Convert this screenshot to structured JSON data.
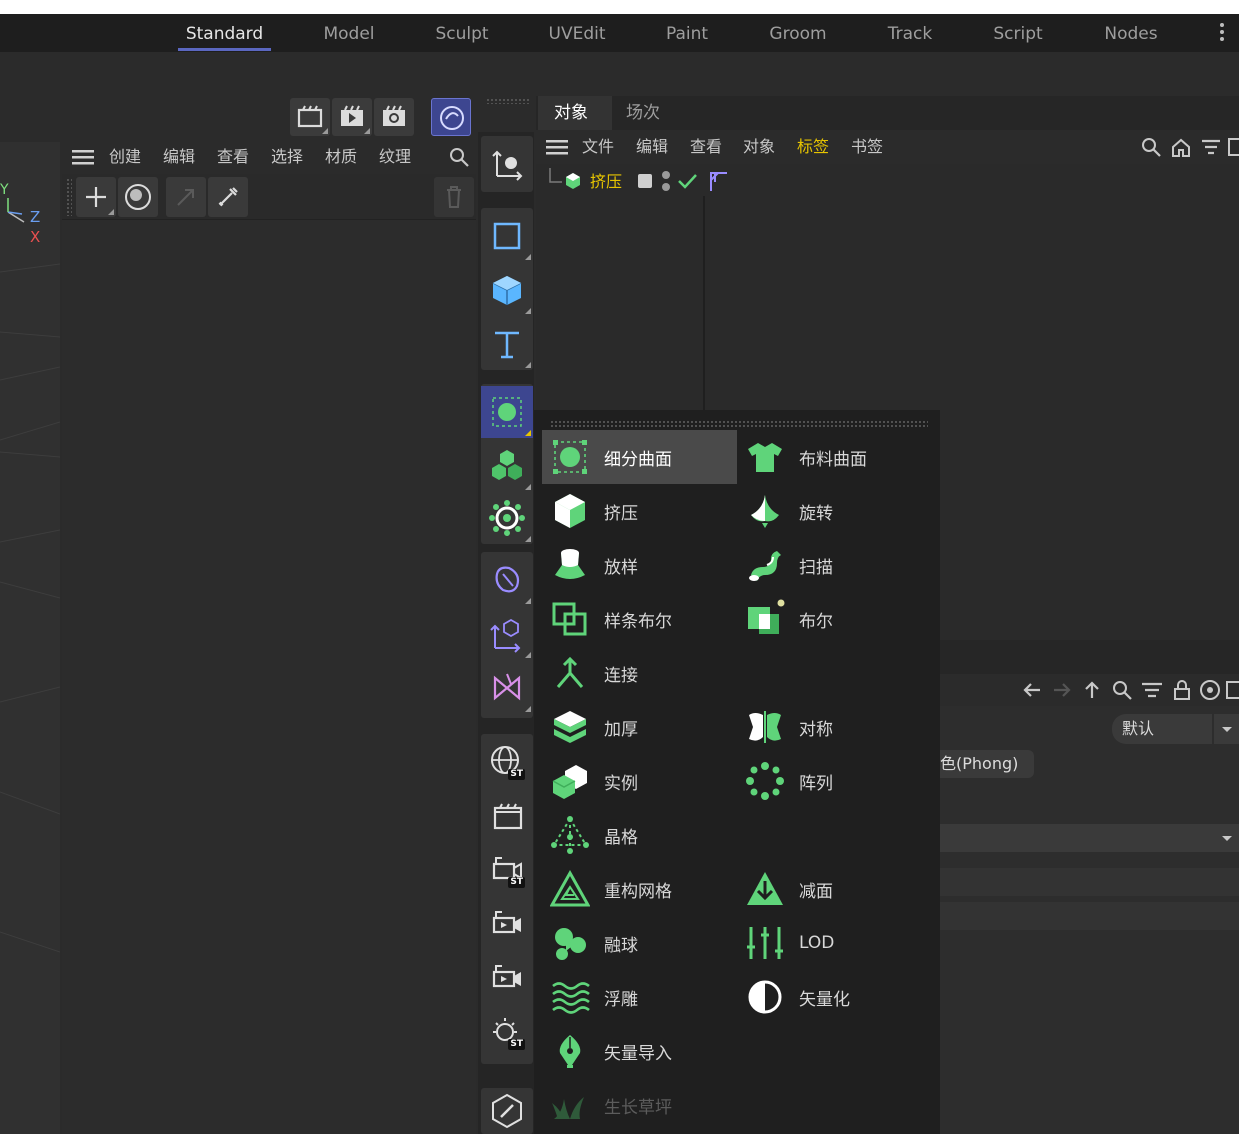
{
  "colors": {
    "accent": "#5b67c0",
    "green": "#5fd47a",
    "violet": "#9a8cff",
    "highlight": "#e6c400"
  },
  "workspace_tabs": [
    {
      "label": "Standard"
    },
    {
      "label": "Model"
    },
    {
      "label": "Sculpt"
    },
    {
      "label": "UVEdit"
    },
    {
      "label": "Paint"
    },
    {
      "label": "Groom"
    },
    {
      "label": "Track"
    },
    {
      "label": "Script"
    },
    {
      "label": "Nodes"
    }
  ],
  "viewport": {
    "axis_y": "Y",
    "axis_z": "Z",
    "axis_x": "X"
  },
  "material_manager": {
    "menu": [
      "创建",
      "编辑",
      "查看",
      "选择",
      "材质",
      "纹理"
    ]
  },
  "object_manager": {
    "tabs": [
      "对象",
      "场次"
    ],
    "menu": [
      "文件",
      "编辑",
      "查看",
      "对象",
      "标签",
      "书签"
    ],
    "object": {
      "name": "挤压"
    }
  },
  "attribute_manager": {
    "mode_dropdown": "默认",
    "tag_label": "色(Phong)"
  },
  "generator_popup": {
    "items": [
      {
        "label": "细分曲面",
        "icon": "subdivision-surface-icon"
      },
      {
        "label": "布料曲面",
        "icon": "cloth-surface-icon"
      },
      {
        "label": "挤压",
        "icon": "extrude-icon"
      },
      {
        "label": "旋转",
        "icon": "lathe-icon"
      },
      {
        "label": "放样",
        "icon": "loft-icon"
      },
      {
        "label": "扫描",
        "icon": "sweep-icon"
      },
      {
        "label": "样条布尔",
        "icon": "spline-boolean-icon"
      },
      {
        "label": "布尔",
        "icon": "boolean-icon"
      },
      {
        "label": "连接",
        "icon": "connect-icon"
      },
      {
        "label": "加厚",
        "icon": "thicken-icon"
      },
      {
        "label": "对称",
        "icon": "symmetry-icon"
      },
      {
        "label": "实例",
        "icon": "instance-icon"
      },
      {
        "label": "阵列",
        "icon": "array-icon"
      },
      {
        "label": "晶格",
        "icon": "atom-array-icon"
      },
      {
        "label": "重构网格",
        "icon": "remesh-icon"
      },
      {
        "label": "减面",
        "icon": "polygon-reduction-icon"
      },
      {
        "label": "融球",
        "icon": "metaball-icon"
      },
      {
        "label": "LOD",
        "icon": "lod-icon"
      },
      {
        "label": "浮雕",
        "icon": "relief-icon"
      },
      {
        "label": "矢量化",
        "icon": "vectorizer-icon"
      },
      {
        "label": "矢量导入",
        "icon": "vector-import-icon"
      },
      {
        "label": "生长草坪",
        "icon": "grass-icon"
      }
    ]
  }
}
